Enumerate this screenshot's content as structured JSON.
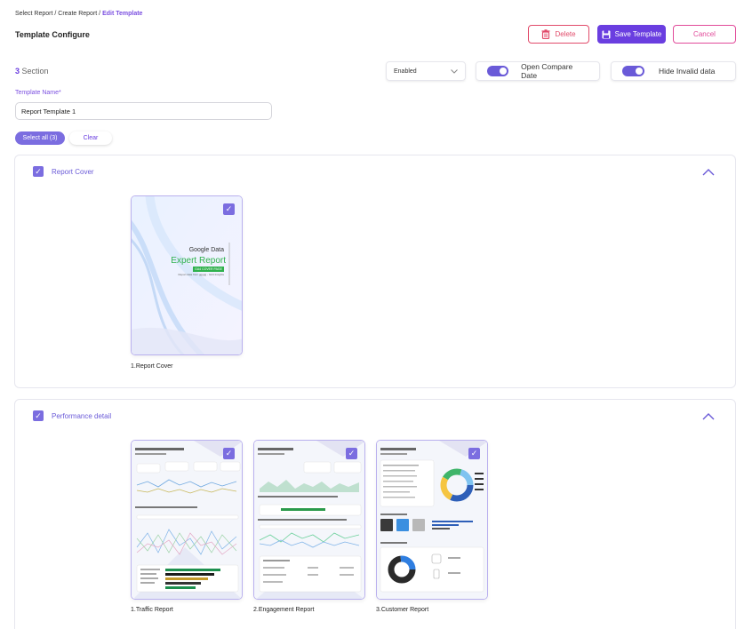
{
  "breadcrumb": {
    "items": [
      "Select Report",
      "Create Report"
    ],
    "separator": " / ",
    "current": "Edit Template"
  },
  "page": {
    "title": "Template Configure"
  },
  "toolbar": {
    "delete_label": "Delete",
    "save_label": "Save Template",
    "cancel_label": "Cancel"
  },
  "section_info": {
    "count": "3",
    "label": "Section"
  },
  "status_select": {
    "value": "Enabled"
  },
  "toggles": {
    "compare_date": "Open Compare Date",
    "hide_invalid": "Hide Invalid data"
  },
  "form": {
    "name_label": "Template Name*",
    "name_value": "Report Template 1"
  },
  "selection": {
    "select_all": "Select all (3)",
    "clear": "Clear"
  },
  "sections": [
    {
      "title": "Report Cover",
      "checked": true,
      "items": [
        {
          "caption": "1.Report Cover",
          "checked": true,
          "cover": {
            "line1": "Google Data",
            "line2": "Expert Report",
            "tag": "GA4 COVER PAGE",
            "date": "Report data from ggggg - GA4 Insights"
          }
        }
      ]
    },
    {
      "title": "Performance detail",
      "checked": true,
      "items": [
        {
          "caption": "1.Traffic Report",
          "checked": true
        },
        {
          "caption": "2.Engagement Report",
          "checked": true
        },
        {
          "caption": "3.Customer Report",
          "checked": true
        }
      ]
    }
  ],
  "colors": {
    "accent": "#6a3ee0",
    "danger": "#e14b6a",
    "cancel": "#e14b9a",
    "check": "#7b6de0"
  },
  "icons": {
    "delete": "trash-icon",
    "save": "save-icon",
    "dropdown": "chevron-down-icon",
    "collapse": "chevron-up-icon",
    "check": "checkmark-icon"
  }
}
